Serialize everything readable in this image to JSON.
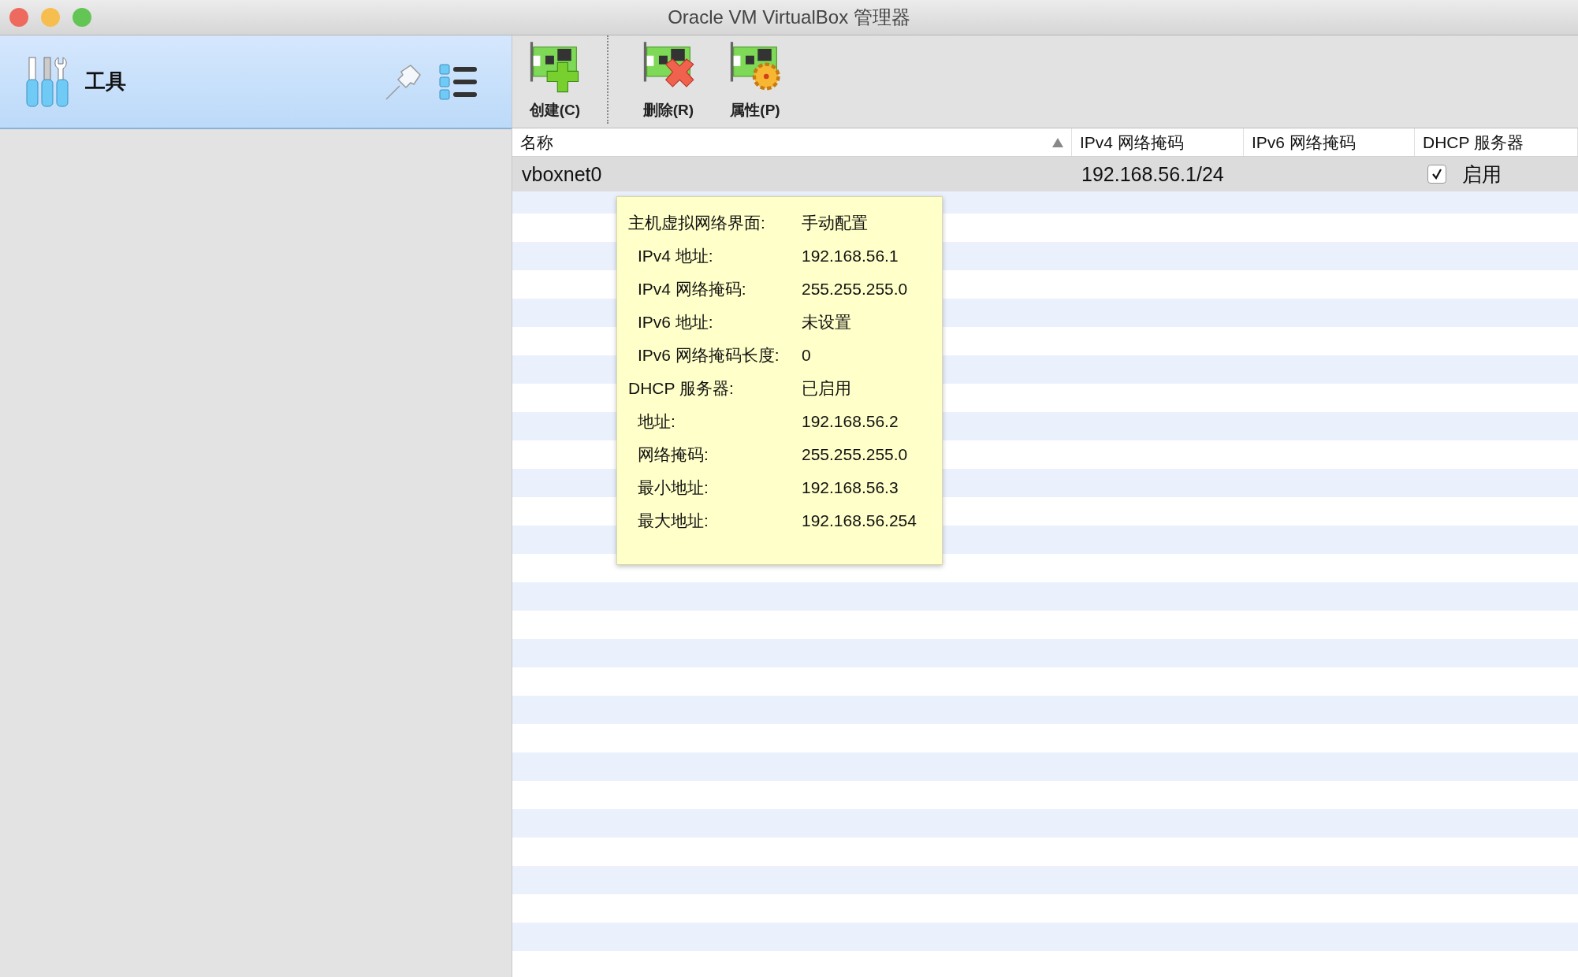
{
  "window": {
    "title": "Oracle VM VirtualBox 管理器"
  },
  "sidebar": {
    "header": {
      "label": "工具"
    }
  },
  "toolbar": {
    "buttons": [
      {
        "kind": "create",
        "label": "创建(C)"
      },
      {
        "kind": "remove",
        "label": "删除(R)"
      },
      {
        "kind": "properties",
        "label": "属性(P)"
      }
    ]
  },
  "table": {
    "columns": [
      {
        "label": "名称",
        "sorted": true
      },
      {
        "label": "IPv4 网络掩码",
        "sorted": false
      },
      {
        "label": "IPv6 网络掩码",
        "sorted": false
      },
      {
        "label": "DHCP 服务器",
        "sorted": false
      }
    ],
    "rows": [
      {
        "name": "vboxnet0",
        "ipv4": "192.168.56.1/24",
        "dhcp_checked": true,
        "dhcp_label": "启用",
        "selected": true
      }
    ]
  },
  "tooltip": {
    "rows": [
      {
        "kind": "section",
        "label": "主机虚拟网络界面:",
        "value": "手动配置"
      },
      {
        "kind": "field",
        "label": "IPv4 地址:",
        "value": "192.168.56.1"
      },
      {
        "kind": "field",
        "label": "IPv4 网络掩码:",
        "value": "255.255.255.0"
      },
      {
        "kind": "field",
        "label": "IPv6 地址:",
        "value": "未设置"
      },
      {
        "kind": "field",
        "label": "IPv6 网络掩码长度:",
        "value": "0"
      },
      {
        "kind": "section",
        "label": "DHCP 服务器:",
        "value": "已启用"
      },
      {
        "kind": "field",
        "label": "地址:",
        "value": "192.168.56.2"
      },
      {
        "kind": "field",
        "label": "网络掩码:",
        "value": "255.255.255.0"
      },
      {
        "kind": "field",
        "label": "最小地址:",
        "value": "192.168.56.3"
      },
      {
        "kind": "field",
        "label": "最大地址:",
        "value": "192.168.56.254"
      }
    ]
  }
}
